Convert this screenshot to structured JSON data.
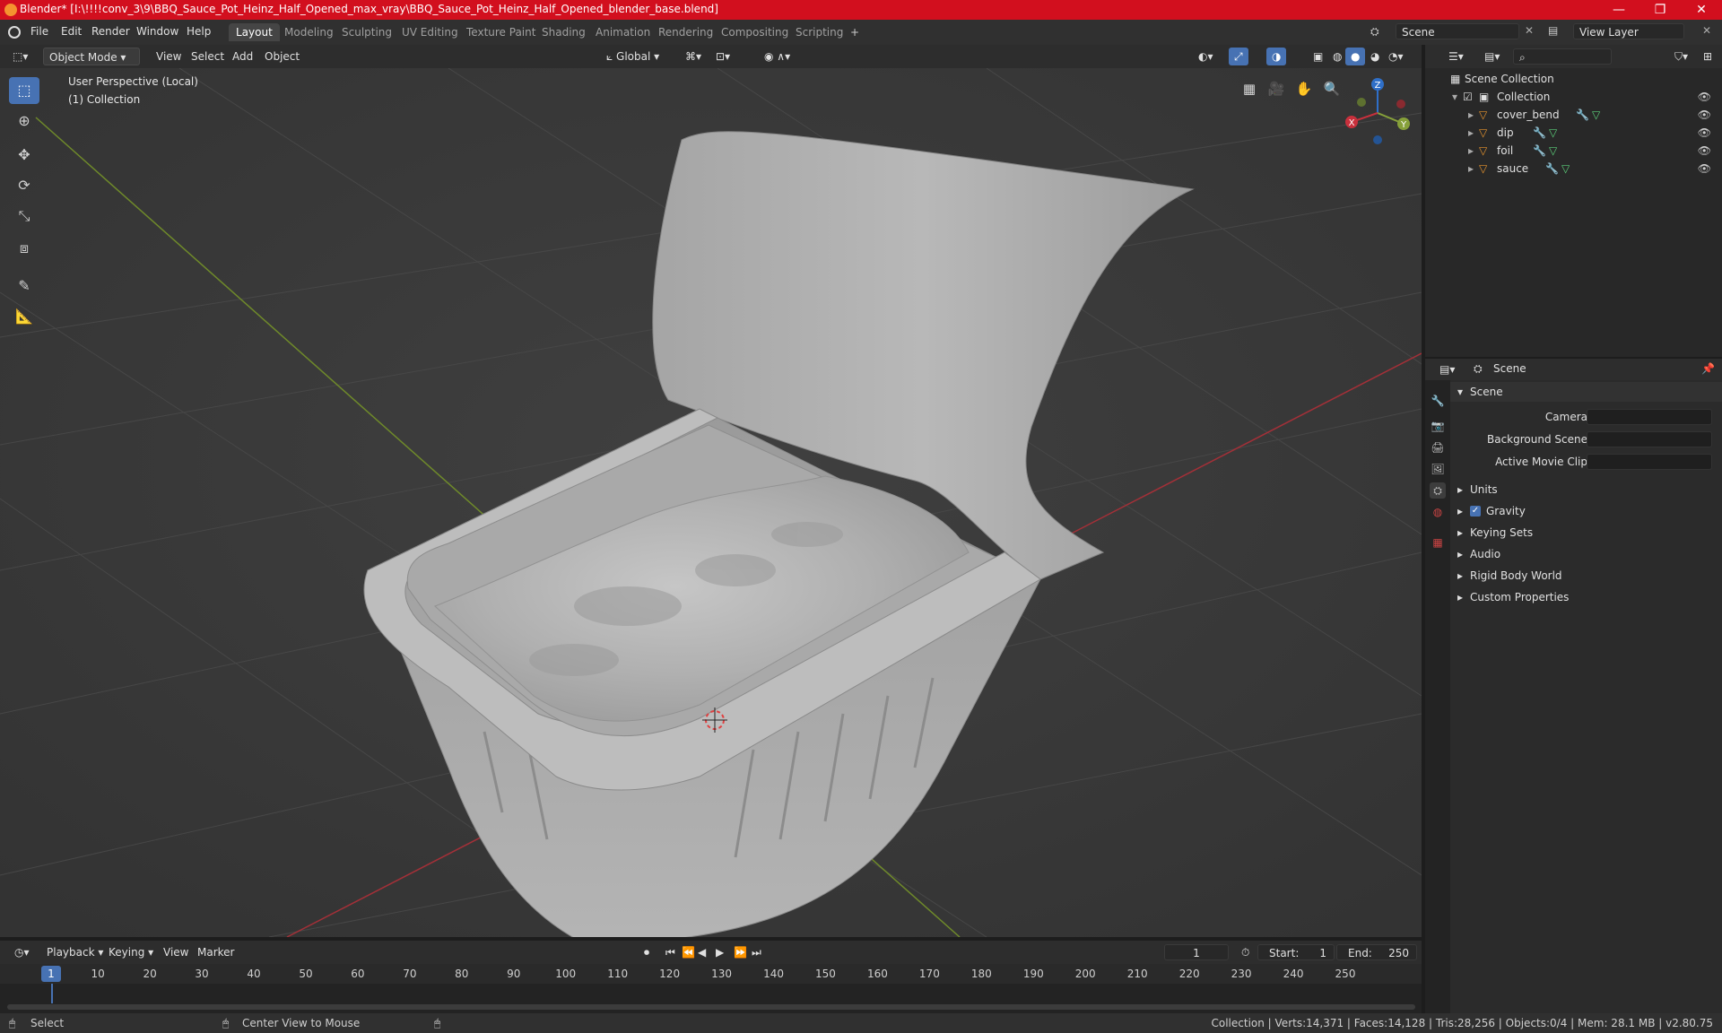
{
  "window": {
    "title": "Blender* [I:\\!!!!conv_3\\9\\BBQ_Sauce_Pot_Heinz_Half_Opened_max_vray\\BBQ_Sauce_Pot_Heinz_Half_Opened_blender_base.blend]",
    "minimize": "—",
    "maximize": "❐",
    "close": "✕"
  },
  "menu": {
    "file": "File",
    "edit": "Edit",
    "render": "Render",
    "window": "Window",
    "help": "Help"
  },
  "workspaces": [
    "Layout",
    "Modeling",
    "Sculpting",
    "UV Editing",
    "Texture Paint",
    "Shading",
    "Animation",
    "Rendering",
    "Compositing",
    "Scripting"
  ],
  "workspace_add": "+",
  "scene_field": "Scene",
  "view_layer_field": "View Layer",
  "viewport_header": {
    "mode": "Object Mode",
    "view": "View",
    "select": "Select",
    "add": "Add",
    "object": "Object",
    "orientation": "Global"
  },
  "viewport": {
    "perspective": "User Perspective (Local)",
    "collection": "(1) Collection",
    "gizmo": {
      "x": "X",
      "y": "Y",
      "z": "Z"
    }
  },
  "outliner": {
    "root": "Scene Collection",
    "collection": "Collection",
    "items": [
      "cover_bend",
      "dip",
      "foil",
      "sauce"
    ]
  },
  "properties": {
    "header": "Scene",
    "section": "Scene",
    "fields": [
      {
        "label": "Camera"
      },
      {
        "label": "Background Scene"
      },
      {
        "label": "Active Movie Clip"
      }
    ],
    "panels": [
      "Units",
      "Gravity",
      "Keying Sets",
      "Audio",
      "Rigid Body World",
      "Custom Properties"
    ],
    "gravity_checked": true
  },
  "timeline": {
    "playback": "Playback",
    "keying": "Keying",
    "view": "View",
    "marker": "Marker",
    "current_frame": "1",
    "start_label": "Start:",
    "start": "1",
    "end_label": "End:",
    "end": "250",
    "ticks": [
      "1",
      "10",
      "20",
      "30",
      "40",
      "50",
      "60",
      "70",
      "80",
      "90",
      "100",
      "110",
      "120",
      "130",
      "140",
      "150",
      "160",
      "170",
      "180",
      "190",
      "200",
      "210",
      "220",
      "230",
      "240",
      "250"
    ]
  },
  "statusbar": {
    "select": "Select",
    "center": "Center View to Mouse",
    "stats": "Collection | Verts:14,371 | Faces:14,128 | Tris:28,256 | Objects:0/4 | Mem: 28.1 MB | v2.80.75"
  },
  "colors": {
    "accent": "#4772b3",
    "titlebar": "#d20f1e",
    "x_axis": "#c8303c",
    "y_axis": "#86a03a",
    "z_axis": "#2f6fc8"
  }
}
